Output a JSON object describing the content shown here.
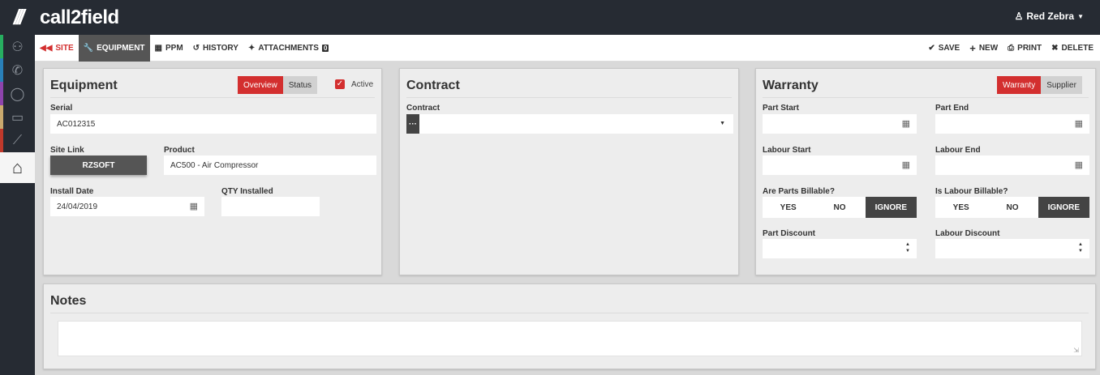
{
  "app": {
    "logo_mark": "///",
    "name": "call2field"
  },
  "user": {
    "name": "Red Zebra",
    "icon": "user-icon"
  },
  "sidebar": {
    "items": [
      {
        "icon": "person-icon",
        "glyph": "⚇",
        "stripe": "#27ae60"
      },
      {
        "icon": "phone-icon",
        "glyph": "✆",
        "stripe": "#2980b9"
      },
      {
        "icon": "chat-icon",
        "glyph": "◯",
        "stripe": "#8e44ad"
      },
      {
        "icon": "wallet-icon",
        "glyph": "▭",
        "stripe": "#c9a96e"
      },
      {
        "icon": "trend-icon",
        "glyph": "⟋",
        "stripe": "#c0392b"
      },
      {
        "icon": "home-icon",
        "glyph": "⌂",
        "stripe": "#f5f5f5",
        "active": true
      }
    ]
  },
  "toolbar": {
    "site": "SITE",
    "equipment": "EQUIPMENT",
    "ppm": "PPM",
    "history": "HISTORY",
    "attachments": "ATTACHMENTS",
    "attachments_count": "0",
    "save": "SAVE",
    "new": "NEW",
    "print": "PRINT",
    "delete": "DELETE"
  },
  "equipment": {
    "title": "Equipment",
    "tab_overview": "Overview",
    "tab_status": "Status",
    "active_label": "Active",
    "active_checked": true,
    "serial_label": "Serial",
    "serial_value": "AC012315",
    "site_link_label": "Site Link",
    "site_link_button": "RZSOFT",
    "product_label": "Product",
    "product_value": "AC500 - Air Compressor",
    "install_date_label": "Install Date",
    "install_date_value": "24/04/2019",
    "qty_label": "QTY Installed",
    "qty_value": ""
  },
  "contract": {
    "title": "Contract",
    "contract_label": "Contract",
    "contract_value": "",
    "dots": "···"
  },
  "warranty": {
    "title": "Warranty",
    "tab_warranty": "Warranty",
    "tab_supplier": "Supplier",
    "part_start_label": "Part Start",
    "part_end_label": "Part End",
    "labour_start_label": "Labour Start",
    "labour_end_label": "Labour End",
    "parts_billable_label": "Are Parts Billable?",
    "labour_billable_label": "Is Labour Billable?",
    "billable_options": [
      "YES",
      "NO",
      "IGNORE"
    ],
    "parts_billable_selected": "IGNORE",
    "labour_billable_selected": "IGNORE",
    "part_discount_label": "Part Discount",
    "labour_discount_label": "Labour Discount"
  },
  "notes": {
    "title": "Notes",
    "value": ""
  },
  "colors": {
    "accent": "#d32f2f",
    "dark": "#262b33",
    "button_dark": "#555555"
  }
}
